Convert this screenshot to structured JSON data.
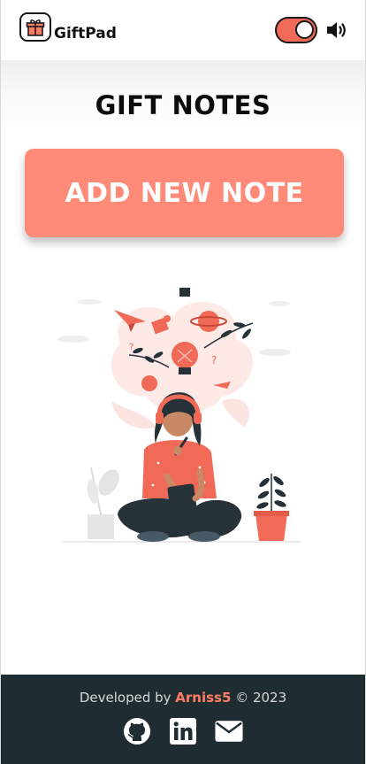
{
  "header": {
    "app_name": "GiftPad",
    "logo_icon": "gift-icon",
    "theme_toggle": {
      "state": "on",
      "icon": "toggle-icon"
    },
    "sound_icon": "speaker-volume-icon"
  },
  "main": {
    "title": "GIFT NOTES",
    "add_button_label": "ADD NEW NOTE",
    "illustration_icon": "woman-thinking-illustration"
  },
  "footer": {
    "developed_by": "Developed by",
    "author": "Arniss5",
    "copyright": "© 2023",
    "social_links": [
      {
        "icon": "github-icon"
      },
      {
        "icon": "linkedin-icon"
      },
      {
        "icon": "mail-icon"
      }
    ]
  },
  "colors": {
    "accent": "#ff8a78",
    "toggle": "#f06a57",
    "author": "#ff7d63",
    "footer_bg": "#1f2d33"
  }
}
